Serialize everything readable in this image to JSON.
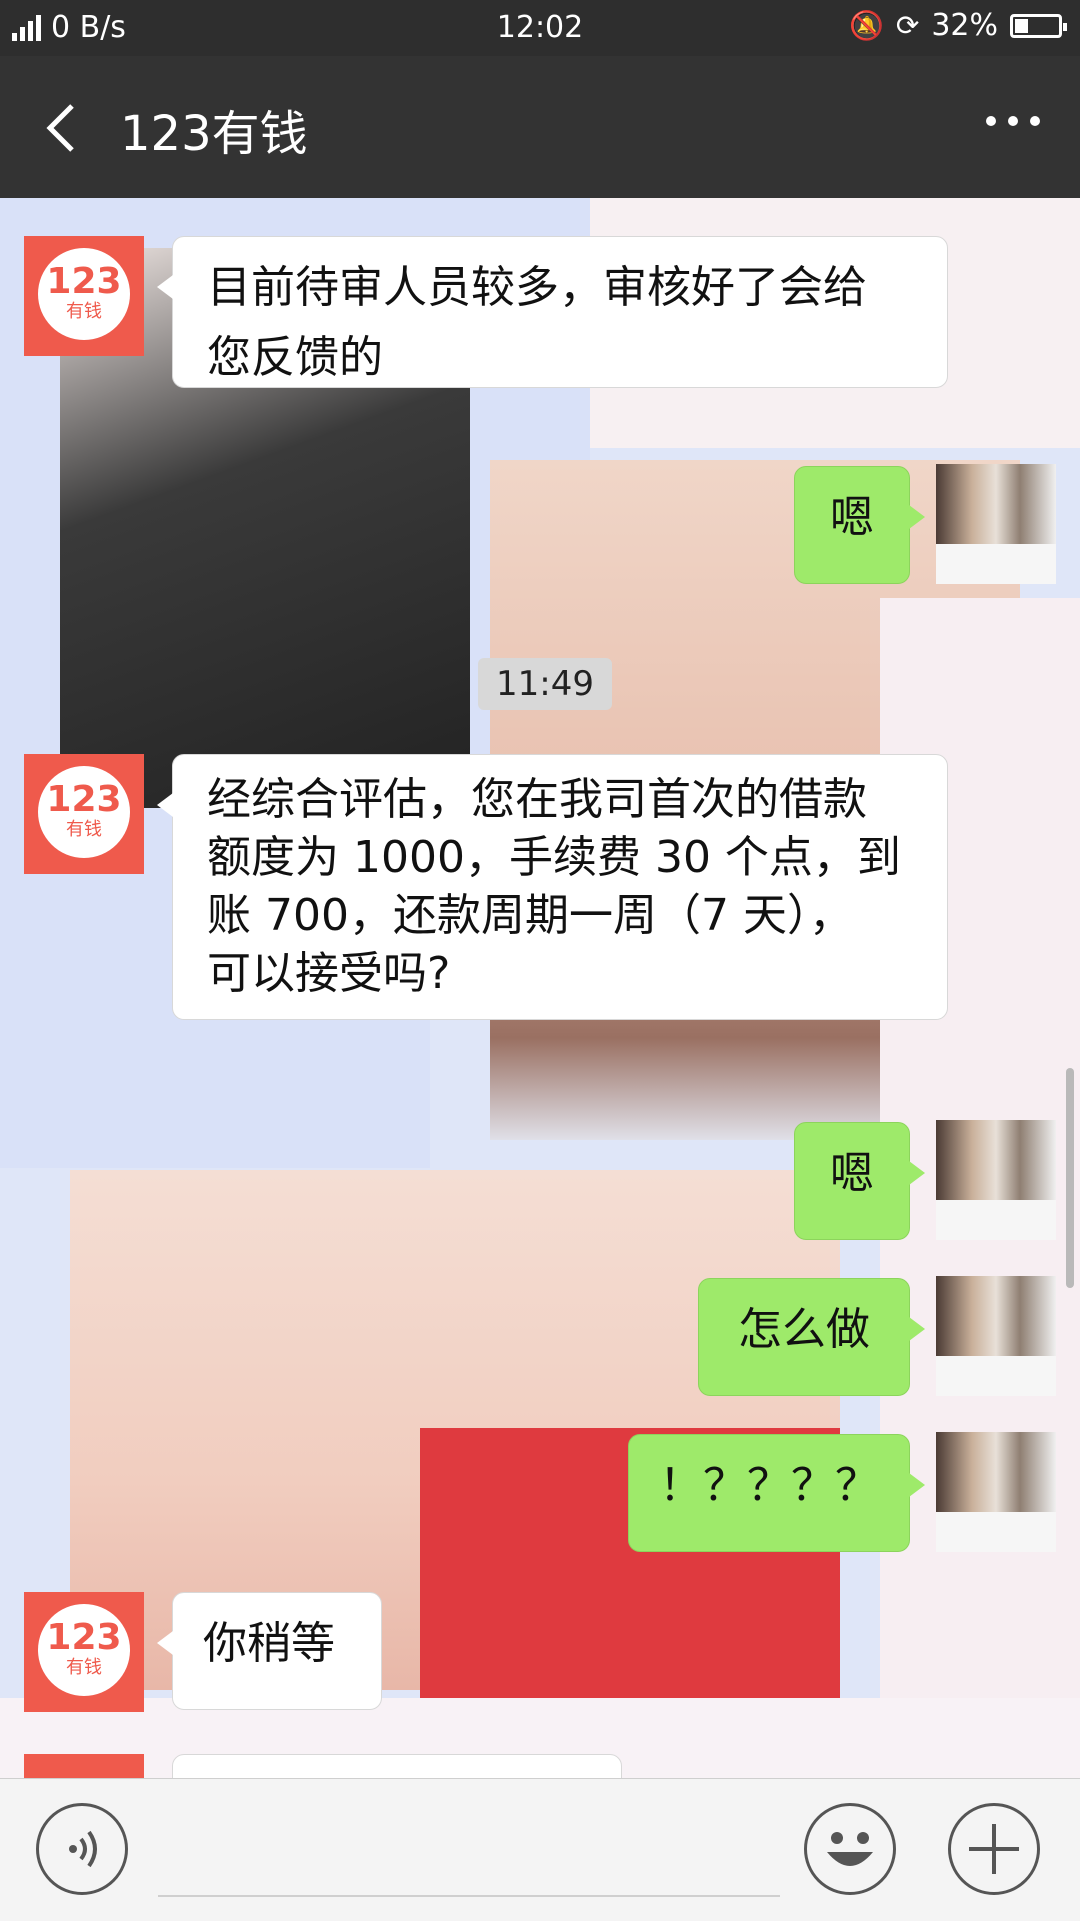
{
  "status_bar": {
    "network": "2G",
    "speed": "0 B/s",
    "time": "12:02",
    "battery": "32%",
    "battery_level": 0.32
  },
  "header": {
    "title": "123有钱",
    "back_icon": "back-arrow-icon",
    "more_icon": "more-dots-icon"
  },
  "bot_avatar": {
    "number": "123",
    "text": "有钱"
  },
  "messages": [
    {
      "from": "bot",
      "text_lines": [
        "目前待审人员较多，审核好了会给",
        "您反馈的"
      ]
    },
    {
      "from": "user",
      "text": "嗯"
    },
    {
      "type": "time",
      "text": "11:49"
    },
    {
      "from": "bot",
      "text_lines": [
        "经综合评估，您在我司首次的借款",
        "额度为 1000，手续费 30 个点，到",
        "账 700，还款周期一周（7 天），",
        "可以接受吗?"
      ]
    },
    {
      "from": "user",
      "text": "嗯"
    },
    {
      "from": "user",
      "text": "怎么做"
    },
    {
      "from": "user",
      "text": "！？？？？"
    },
    {
      "from": "bot",
      "text": "你稍等"
    }
  ],
  "input_bar": {
    "voice_icon": "voice-icon",
    "emoji_icon": "emoji-icon",
    "plus_icon": "plus-icon"
  },
  "colors": {
    "bot_brand": "#ef5a4c",
    "user_bubble": "#9eea6a",
    "title_bar": "#333333"
  }
}
